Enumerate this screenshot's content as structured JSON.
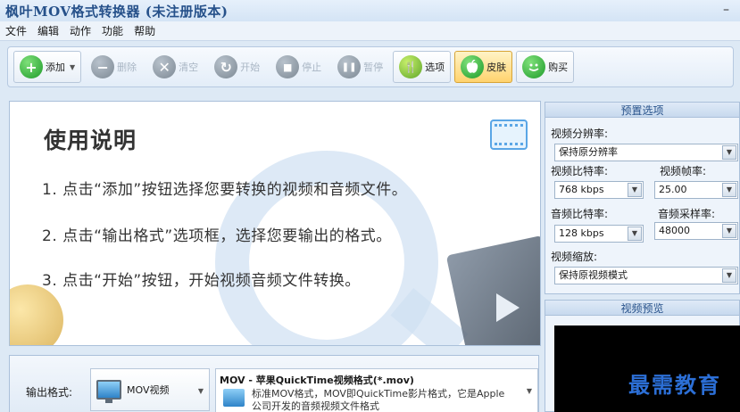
{
  "window": {
    "title": "枫叶MOV格式转换器  (未注册版本)",
    "minimize": "–"
  },
  "menu": [
    "文件",
    "编辑",
    "动作",
    "功能",
    "帮助"
  ],
  "toolbar": {
    "add": {
      "label": "添加",
      "icon": "+"
    },
    "delete": {
      "label": "删除",
      "icon": "−"
    },
    "clear": {
      "label": "清空",
      "icon": "✕"
    },
    "start": {
      "label": "开始",
      "icon": "↻"
    },
    "stop": {
      "label": "停止",
      "icon": "■"
    },
    "pause": {
      "label": "暂停",
      "icon": "❚❚"
    },
    "options": {
      "label": "选项",
      "icon": "🍴"
    },
    "skin": {
      "label": "皮肤",
      "icon": ""
    },
    "buy": {
      "label": "购买",
      "icon": ""
    }
  },
  "instructions": {
    "title": "使用说明",
    "line1": "1. 点击“添加”按钮选择您要转换的视频和音频文件。",
    "line2": "2. 点击“输出格式”选项框，选择您要输出的格式。",
    "line3": "3. 点击“开始”按钮，开始视频音频文件转换。"
  },
  "output": {
    "label": "输出格式:",
    "format": "MOV视频",
    "desc_title": "MOV - 苹果QuickTime视频格式(*.mov)",
    "desc_line1": "标准MOV格式，MOV即QuickTime影片格式，它是Apple",
    "desc_line2": "公司开发的音频视频文件格式"
  },
  "preset": {
    "header": "预置选项",
    "resolution_label": "视频分辨率:",
    "resolution_value": "保持原分辨率",
    "vbitrate_label": "视频比特率:",
    "vbitrate_value": "768 kbps",
    "framerate_label": "视频帧率:",
    "framerate_value": "25.00",
    "abitrate_label": "音频比特率:",
    "abitrate_value": "128 kbps",
    "samplerate_label": "音频采样率:",
    "samplerate_value": "48000",
    "scale_label": "视频缩放:",
    "scale_value": "保持原视频模式"
  },
  "preview": {
    "header": "视频预览"
  },
  "watermark": "最需教育"
}
